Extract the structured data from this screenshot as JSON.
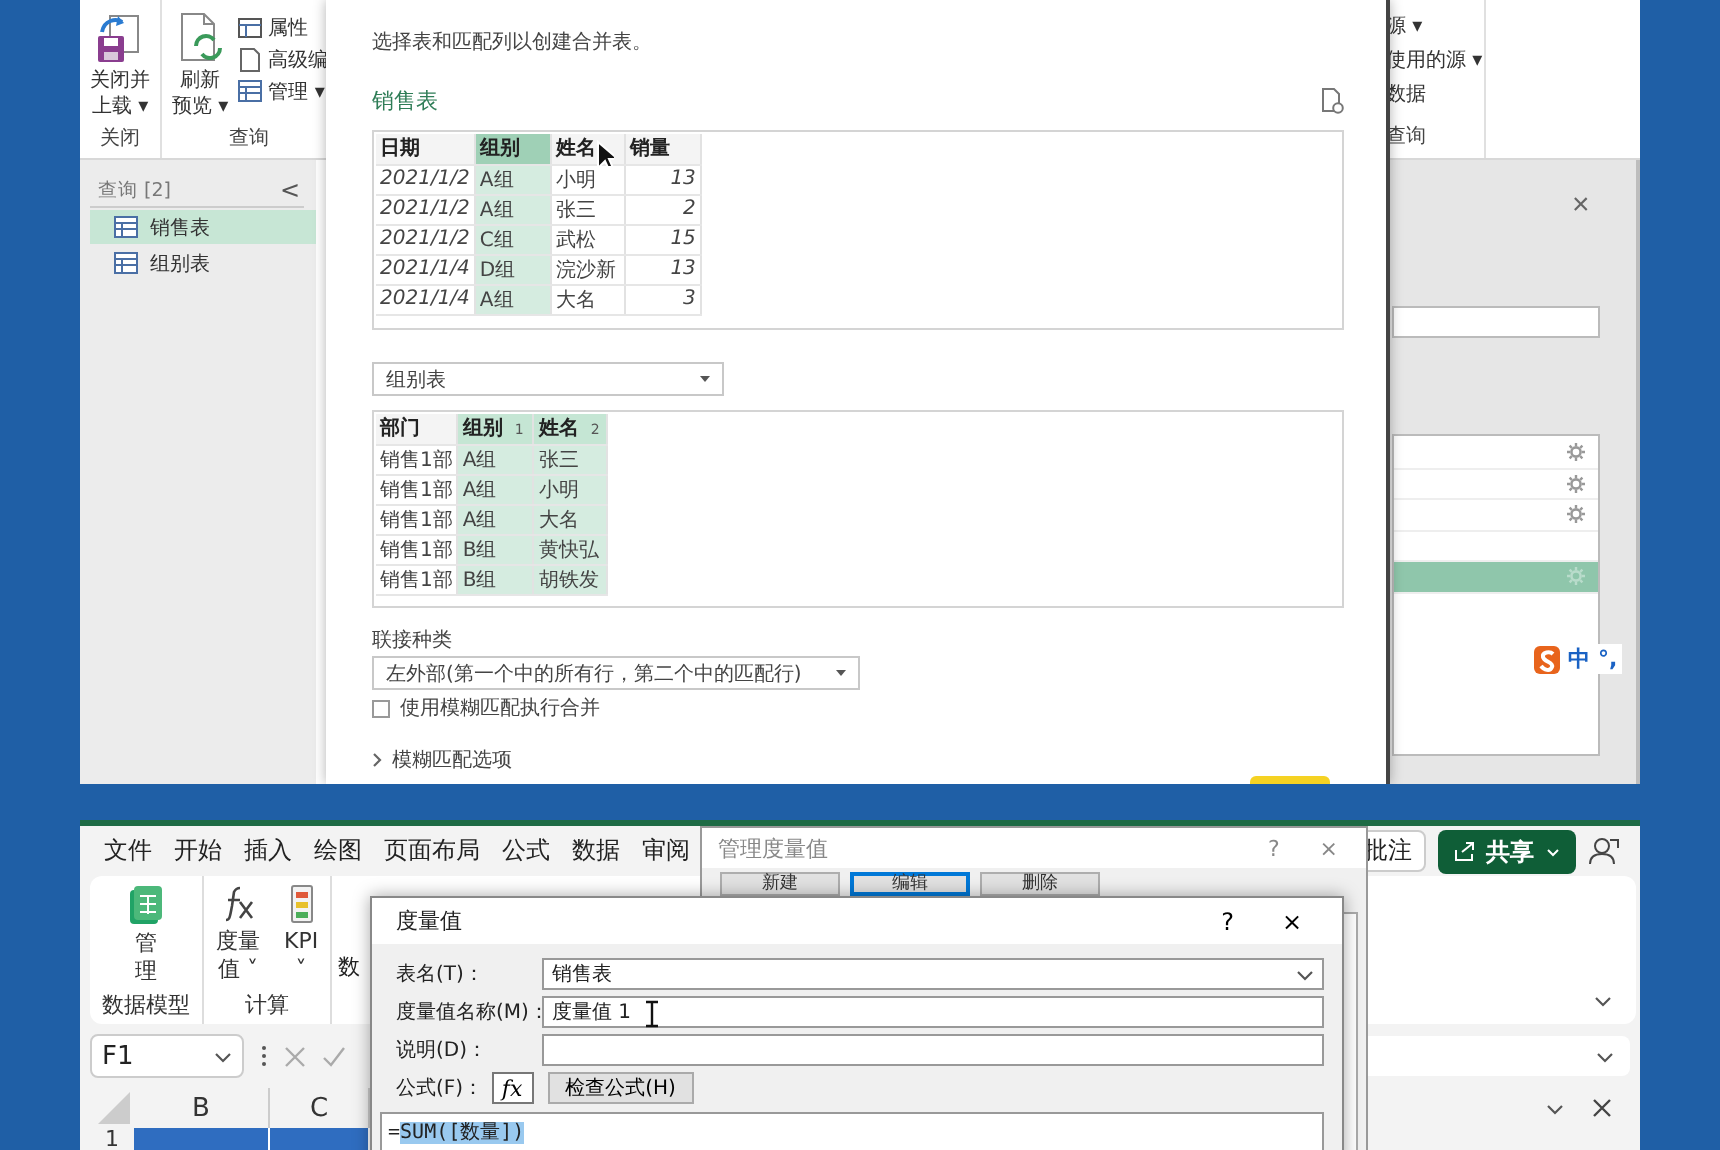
{
  "query_editor": {
    "ribbon": {
      "groups": [
        {
          "label": "关闭",
          "large_buttons": [
            {
              "lines": [
                "关闭并",
                "上载 ▾"
              ]
            }
          ]
        },
        {
          "label": "查询",
          "large_buttons": [
            {
              "lines": [
                "刷新",
                "预览 ▾"
              ]
            }
          ],
          "small_buttons": [
            "属性",
            "高级编",
            "管理 ▾"
          ]
        }
      ],
      "right_fragments": [
        "源 ▾",
        "使用的源 ▾",
        "数据"
      ],
      "right_group_label": "查询"
    },
    "queries_pane": {
      "header": "查询 [2]",
      "collapse": "<",
      "items": [
        {
          "label": "销售表",
          "selected": true
        },
        {
          "label": "组别表",
          "selected": false
        }
      ]
    },
    "settings_pane": {
      "close": "×",
      "rows": [
        {
          "settings": true,
          "selected": false
        },
        {
          "settings": true,
          "selected": false
        },
        {
          "settings": true,
          "selected": false
        },
        {
          "settings": false,
          "selected": false
        },
        {
          "settings": true,
          "selected": true
        }
      ]
    },
    "ime": {
      "lang": "中",
      "punct": "°,"
    }
  },
  "merge_dialog": {
    "subtitle": "选择表和匹配列以创建合并表。",
    "table1": {
      "name": "销售表",
      "columns": [
        {
          "label": "日期",
          "kind": "date",
          "selected": false
        },
        {
          "label": "组别",
          "kind": "text",
          "selected": true
        },
        {
          "label": "姓名",
          "kind": "text",
          "selected": false
        },
        {
          "label": "销量",
          "kind": "number",
          "selected": false
        }
      ],
      "rows": [
        [
          "2021/1/2",
          "A组",
          "小明",
          "13"
        ],
        [
          "2021/1/2",
          "A组",
          "张三",
          "2"
        ],
        [
          "2021/1/2",
          "C组",
          "武松",
          "15"
        ],
        [
          "2021/1/4",
          "D组",
          "浣沙新",
          "13"
        ],
        [
          "2021/1/4",
          "A组",
          "大名",
          "3"
        ]
      ]
    },
    "table2": {
      "source": "组别表",
      "columns": [
        {
          "label": "部门",
          "kind": "text",
          "selected": false
        },
        {
          "label": "组别",
          "kind": "text",
          "selected": true,
          "order": "1"
        },
        {
          "label": "姓名",
          "kind": "text",
          "selected": true,
          "order": "2"
        }
      ],
      "rows": [
        [
          "销售1部",
          "A组",
          "张三"
        ],
        [
          "销售1部",
          "A组",
          "小明"
        ],
        [
          "销售1部",
          "A组",
          "大名"
        ],
        [
          "销售1部",
          "B组",
          "黄快弘"
        ],
        [
          "销售1部",
          "B组",
          "胡铁发"
        ]
      ]
    },
    "join_kind": {
      "label": "联接种类",
      "value": "左外部(第一个中的所有行，第二个中的匹配行)"
    },
    "fuzzy": {
      "label": "使用模糊匹配执行合并",
      "checked": false
    },
    "fuzzy_options": {
      "label": "模糊匹配选项",
      "expanded": false
    }
  },
  "excel": {
    "tabs": [
      "文件",
      "开始",
      "插入",
      "绘图",
      "页面布局",
      "公式",
      "数据",
      "审阅"
    ],
    "ribbon_groups": [
      {
        "label": "数据模型",
        "buttons": [
          {
            "lines": [
              "管",
              "理"
            ]
          }
        ]
      },
      {
        "label": "计算",
        "buttons": [
          {
            "lines": [
              "度量",
              "值 ˅"
            ]
          },
          {
            "lines": [
              "KPI",
              "˅"
            ]
          }
        ]
      }
    ],
    "covered_label": "数",
    "name_box": "F1",
    "column_headers": [
      "B",
      "C"
    ],
    "row_headers": [
      "1"
    ],
    "comments_button": "批注",
    "share_button": "共享"
  },
  "manage_dialog": {
    "title": "管理度量值",
    "help": "?",
    "close": "×",
    "buttons": [
      {
        "label": "新建",
        "focused": false
      },
      {
        "label": "编辑",
        "focused": true
      },
      {
        "label": "删除",
        "focused": false
      }
    ]
  },
  "measure_dialog": {
    "title": "度量值",
    "help": "?",
    "close": "×",
    "fields": [
      {
        "kind": "dropdown",
        "label": "表名(T)：",
        "value": "销售表"
      },
      {
        "kind": "text",
        "label": "度量值名称(M)：",
        "value": "度量值 1"
      },
      {
        "kind": "text",
        "label": "说明(D)："
      }
    ],
    "formula_label": "公式(F)：",
    "fx_button": "fx",
    "check_button": "检查公式(H)",
    "formula": {
      "plain": "=",
      "selected": "SUM([数量])"
    }
  }
}
